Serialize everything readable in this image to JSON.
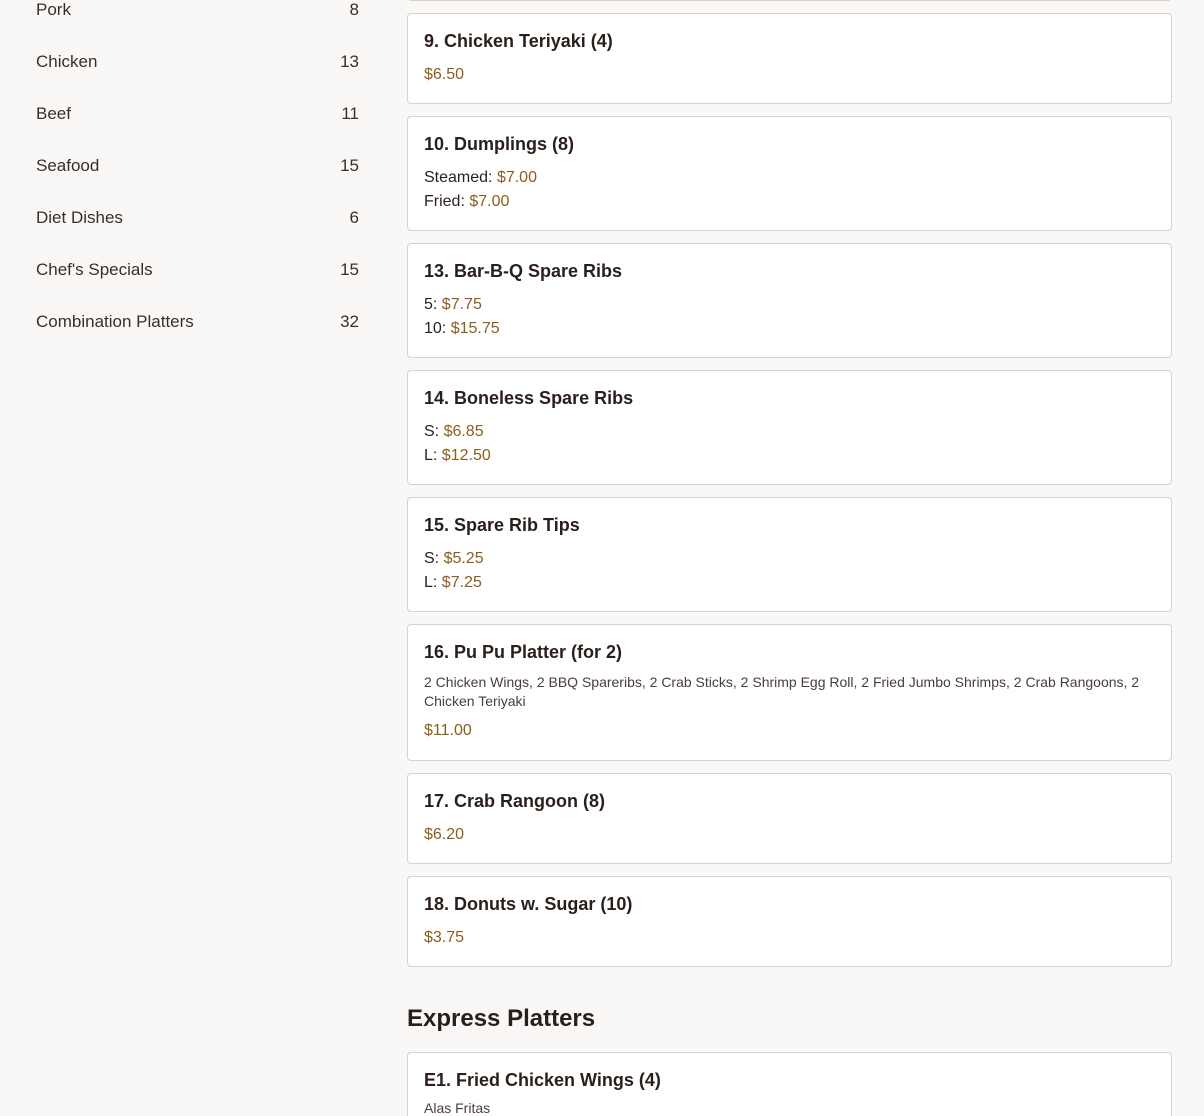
{
  "sidebar": {
    "categories": [
      {
        "name": "Pork",
        "count": "8"
      },
      {
        "name": "Chicken",
        "count": "13"
      },
      {
        "name": "Beef",
        "count": "11"
      },
      {
        "name": "Seafood",
        "count": "15"
      },
      {
        "name": "Diet Dishes",
        "count": "6"
      },
      {
        "name": "Chef's Specials",
        "count": "15"
      },
      {
        "name": "Combination Platters",
        "count": "32"
      }
    ]
  },
  "items": [
    {
      "title": "9. Chicken Teriyaki (4)",
      "prices": [
        {
          "label": "",
          "price": "$6.50"
        }
      ]
    },
    {
      "title": "10. Dumplings (8)",
      "prices": [
        {
          "label": "Steamed: ",
          "price": "$7.00"
        },
        {
          "label": "Fried: ",
          "price": "$7.00"
        }
      ]
    },
    {
      "title": "13. Bar-B-Q Spare Ribs",
      "prices": [
        {
          "label": "5: ",
          "price": "$7.75"
        },
        {
          "label": "10: ",
          "price": "$15.75"
        }
      ]
    },
    {
      "title": "14. Boneless Spare Ribs",
      "prices": [
        {
          "label": "S: ",
          "price": "$6.85"
        },
        {
          "label": "L: ",
          "price": "$12.50"
        }
      ]
    },
    {
      "title": "15. Spare Rib Tips",
      "prices": [
        {
          "label": "S: ",
          "price": "$5.25"
        },
        {
          "label": "L: ",
          "price": "$7.25"
        }
      ]
    },
    {
      "title": "16. Pu Pu Platter (for 2)",
      "description": "2 Chicken Wings, 2 BBQ Spareribs, 2 Crab Sticks, 2 Shrimp Egg Roll, 2 Fried Jumbo Shrimps, 2 Crab Rangoons, 2 Chicken Teriyaki",
      "prices": [
        {
          "label": "",
          "price": "$11.00"
        }
      ]
    },
    {
      "title": "17. Crab Rangoon (8)",
      "prices": [
        {
          "label": "",
          "price": "$6.20"
        }
      ]
    },
    {
      "title": "18. Donuts w. Sugar (10)",
      "prices": [
        {
          "label": "",
          "price": "$3.75"
        }
      ]
    }
  ],
  "express": {
    "heading": "Express Platters",
    "items": [
      {
        "title": "E1. Fried Chicken Wings (4)",
        "description": "Alas Fritas"
      }
    ]
  },
  "colors": {
    "price": "#8a5f1e",
    "background": "#faf8f6",
    "card_border": "#d8d2cc"
  }
}
